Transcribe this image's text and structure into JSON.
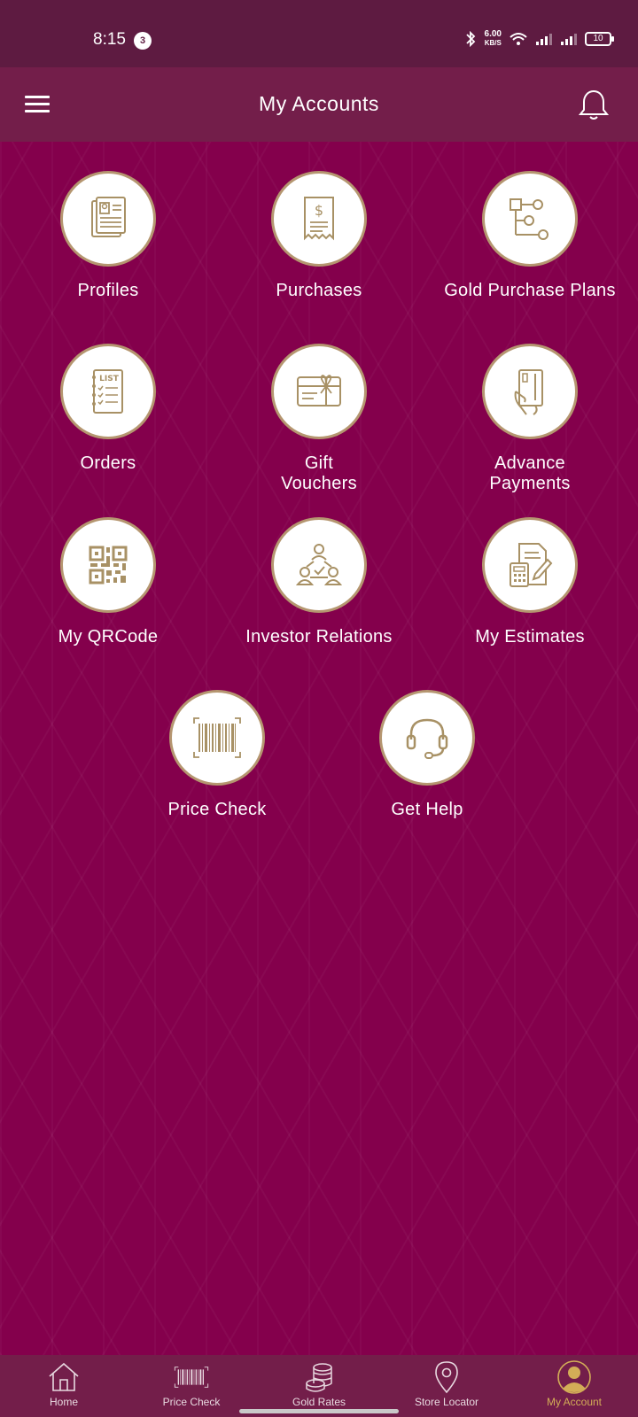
{
  "status_bar": {
    "time": "8:15",
    "notification_count": "3",
    "net_speed_value": "6.00",
    "net_speed_unit": "KB/S",
    "battery": "10"
  },
  "header": {
    "title": "My Accounts",
    "menu_icon": "hamburger-menu-icon",
    "bell_icon": "bell-icon"
  },
  "colors": {
    "background": "#84004c",
    "header": "#731e4a",
    "status_bar": "#5e1b41",
    "gold": "#a89165",
    "active_nav": "#d3ad57"
  },
  "grid": {
    "items": [
      {
        "label": "Profiles",
        "icon": "profile-document-icon"
      },
      {
        "label": "Purchases",
        "icon": "receipt-dollar-icon"
      },
      {
        "label": "Gold Purchase Plans",
        "icon": "flow-plan-icon"
      },
      {
        "label": "Orders",
        "icon": "order-list-icon"
      },
      {
        "label": "Gift\nVouchers",
        "icon": "gift-voucher-icon"
      },
      {
        "label": "Advance\nPayments",
        "icon": "card-payment-icon"
      },
      {
        "label": "My QRCode",
        "icon": "qr-code-icon"
      },
      {
        "label": "Investor Relations",
        "icon": "investor-network-icon"
      },
      {
        "label": "My Estimates",
        "icon": "calculator-document-icon"
      },
      {
        "label": "Price Check",
        "icon": "barcode-icon"
      },
      {
        "label": "Get Help",
        "icon": "headset-icon"
      }
    ]
  },
  "bottom_nav": {
    "items": [
      {
        "label": "Home",
        "icon": "home-icon"
      },
      {
        "label": "Price Check",
        "icon": "barcode-icon"
      },
      {
        "label": "Gold Rates",
        "icon": "coins-stack-icon"
      },
      {
        "label": "Store Locator",
        "icon": "map-pin-icon"
      },
      {
        "label": "My Account",
        "icon": "account-avatar-icon",
        "active": true
      }
    ]
  }
}
